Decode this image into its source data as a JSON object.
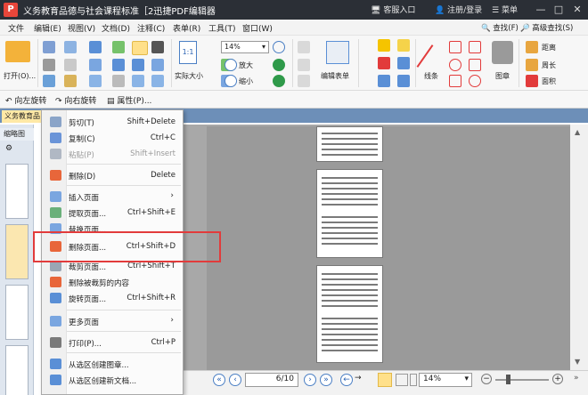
{
  "titlebar": {
    "app_icon": "P",
    "title": "义务教育品德与社会课程标准［2迅捷PDF编辑器",
    "customer": "客服入口",
    "login": "注册/登录",
    "menu": "菜单",
    "minimize": "—",
    "maximize": "□",
    "close": "✕"
  },
  "menubar": [
    "文件",
    "编辑(E)",
    "视图(V)",
    "文档(D)",
    "注释(C)",
    "表单(R)",
    "工具(T)",
    "窗口(W)"
  ],
  "ribbon": {
    "open_label": "打开(O)...",
    "actual_size_label": "实际大小",
    "zoom_value": "14%",
    "zoom_in_label": "放大",
    "zoom_out_label": "缩小",
    "edit_form_label": "编辑表单",
    "line_label": "线条",
    "stamp_label": "图章",
    "find_label": "查找(F)",
    "advanced_find_label": "高级查找(S)",
    "distance_label": "距离",
    "perimeter_label": "周长",
    "area_label": "面积"
  },
  "toolbar2": {
    "rotate_left": "向左旋转",
    "rotate_right": "向右旋转",
    "properties": "属性(P)..."
  },
  "doc_tab": "义务教育品",
  "left_panel": {
    "header": "缩略图"
  },
  "context_menu": [
    {
      "label": "剪切(T)",
      "shortcut": "Shift+Delete",
      "disabled": false,
      "icon": "scissors-icon"
    },
    {
      "label": "复制(C)",
      "shortcut": "Ctrl+C",
      "disabled": false,
      "icon": "copy-icon"
    },
    {
      "label": "粘贴(P)",
      "shortcut": "Shift+Insert",
      "disabled": true,
      "icon": "paste-icon"
    },
    {
      "label": "删除(D)",
      "shortcut": "Delete",
      "disabled": false,
      "icon": "trash-icon"
    },
    {
      "label": "插入页面",
      "shortcut": "",
      "disabled": false,
      "submenu": true,
      "icon": "insert-page-icon"
    },
    {
      "label": "提取页面...",
      "shortcut": "Ctrl+Shift+E",
      "disabled": false,
      "icon": "extract-page-icon"
    },
    {
      "label": "替换页面...",
      "shortcut": "",
      "disabled": false,
      "icon": "replace-page-icon"
    },
    {
      "label": "删除页面...",
      "shortcut": "Ctrl+Shift+D",
      "disabled": false,
      "icon": "delete-page-icon"
    },
    {
      "label": "裁剪页面...",
      "shortcut": "Ctrl+Shift+T",
      "disabled": false,
      "icon": "crop-page-icon"
    },
    {
      "label": "删除被裁剪的内容",
      "shortcut": "",
      "disabled": false,
      "icon": "remove-cropped-icon"
    },
    {
      "label": "旋转页面...",
      "shortcut": "Ctrl+Shift+R",
      "disabled": false,
      "icon": "rotate-page-icon"
    },
    {
      "label": "更多页面",
      "shortcut": "",
      "disabled": false,
      "submenu": true,
      "icon": "more-pages-icon"
    },
    {
      "label": "打印(P)...",
      "shortcut": "Ctrl+P",
      "disabled": false,
      "icon": "printer-icon"
    },
    {
      "label": "从选区创建图章...",
      "shortcut": "",
      "disabled": false,
      "icon": "create-stamp-icon"
    },
    {
      "label": "从选区创建新文档...",
      "shortcut": "",
      "disabled": false,
      "icon": "create-doc-icon"
    }
  ],
  "status": {
    "page_value": "6/10",
    "zoom_value": "14%"
  },
  "colors": {
    "highlight": "#e23b3b",
    "titlebar": "#2b2f36",
    "tabstrip": "#6d8fb8"
  }
}
